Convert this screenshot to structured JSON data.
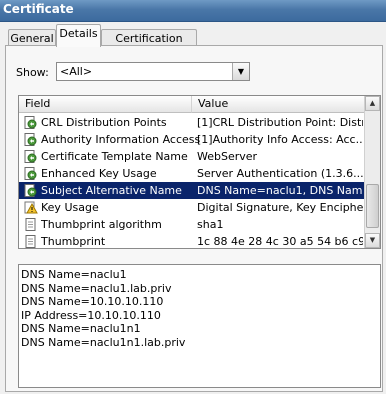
{
  "window": {
    "title": "Certificate"
  },
  "tabs": [
    {
      "label": "General"
    },
    {
      "label": "Details"
    },
    {
      "label": "Certification Path"
    }
  ],
  "show": {
    "label": "Show:",
    "value": "<All>"
  },
  "table": {
    "columns": [
      "Field",
      "Value"
    ],
    "rows": [
      {
        "field": "CRL Distribution Points",
        "value": "[1]CRL Distribution Point: Distr...",
        "icon": "certificate-extension-icon"
      },
      {
        "field": "Authority Information Access",
        "value": "[1]Authority Info Access: Acc...",
        "icon": "certificate-extension-icon"
      },
      {
        "field": "Certificate Template Name",
        "value": "WebServer",
        "icon": "certificate-extension-icon"
      },
      {
        "field": "Enhanced Key Usage",
        "value": "Server Authentication (1.3.6....",
        "icon": "certificate-extension-icon"
      },
      {
        "field": "Subject Alternative Name",
        "value": "DNS Name=naclu1, DNS Name...",
        "icon": "certificate-extension-icon",
        "selected": true
      },
      {
        "field": "Key Usage",
        "value": "Digital Signature, Key Encipher...",
        "icon": "warning-extension-icon"
      },
      {
        "field": "Thumbprint algorithm",
        "value": "sha1",
        "icon": "document-icon"
      },
      {
        "field": "Thumbprint",
        "value": "1c 88 4e 28 4c 30 a5 54 b6 c9 ...",
        "icon": "document-icon"
      }
    ]
  },
  "details_lines": [
    "DNS Name=naclu1",
    "DNS Name=naclu1.lab.priv",
    "DNS Name=10.10.10.110",
    "IP Address=10.10.10.110",
    "DNS Name=naclu1n1",
    "DNS Name=naclu1n1.lab.priv"
  ],
  "colors": {
    "selection": "#0a246a",
    "titlebar": "#4a77a8"
  }
}
